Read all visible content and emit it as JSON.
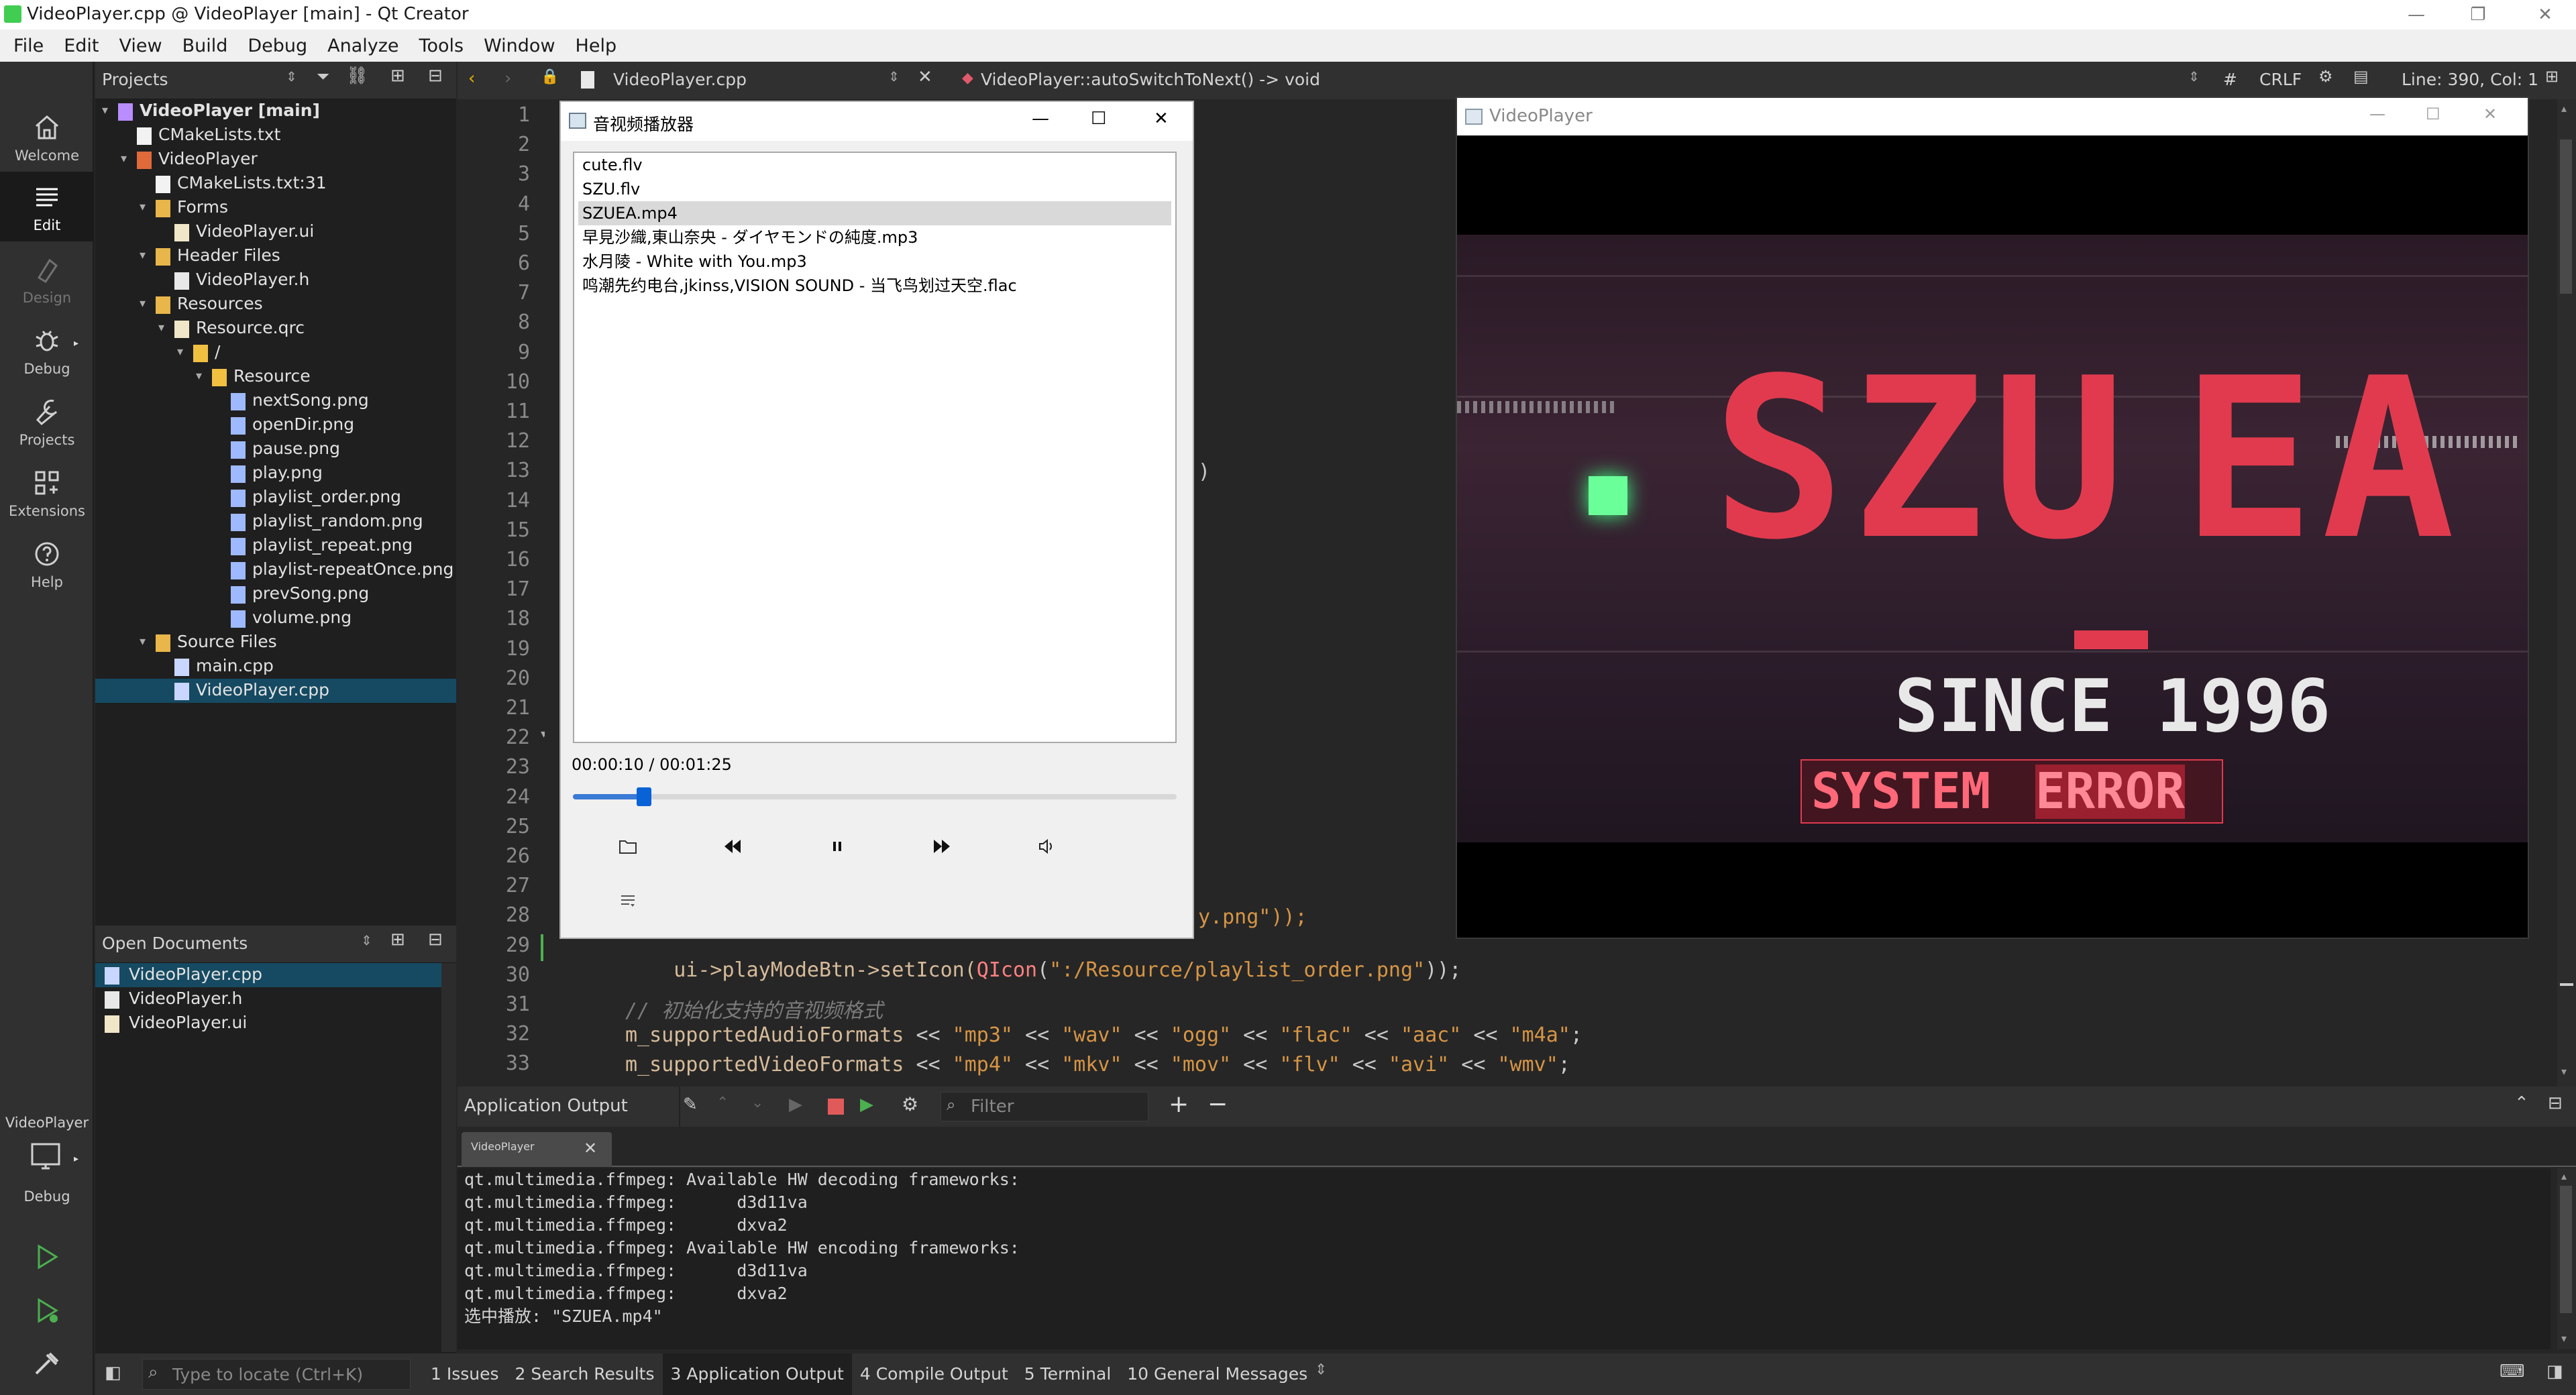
{
  "titlebar": {
    "title": "VideoPlayer.cpp @ VideoPlayer [main] - Qt Creator"
  },
  "menubar": {
    "items": [
      "File",
      "Edit",
      "View",
      "Build",
      "Debug",
      "Analyze",
      "Tools",
      "Window",
      "Help"
    ]
  },
  "modes": [
    {
      "label": "Welcome",
      "icon": "home-icon"
    },
    {
      "label": "Edit",
      "icon": "edit-icon"
    },
    {
      "label": "Design",
      "icon": "design-icon"
    },
    {
      "label": "Debug",
      "icon": "debug-icon"
    },
    {
      "label": "Projects",
      "icon": "wrench-icon"
    },
    {
      "label": "Extensions",
      "icon": "extensions-icon"
    },
    {
      "label": "Help",
      "icon": "help-icon"
    }
  ],
  "kit": {
    "project": "VideoPlayer",
    "mode": "Debug"
  },
  "projects": {
    "header": "Projects",
    "tree": [
      {
        "label": "VideoPlayer [main]",
        "bold": true
      },
      {
        "label": "CMakeLists.txt"
      },
      {
        "label": "VideoPlayer"
      },
      {
        "label": "CMakeLists.txt:31"
      },
      {
        "label": "Forms"
      },
      {
        "label": "VideoPlayer.ui"
      },
      {
        "label": "Header Files"
      },
      {
        "label": "VideoPlayer.h"
      },
      {
        "label": "Resources"
      },
      {
        "label": "Resource.qrc"
      },
      {
        "label": "/"
      },
      {
        "label": "Resource"
      },
      {
        "label": "nextSong.png"
      },
      {
        "label": "openDir.png"
      },
      {
        "label": "pause.png"
      },
      {
        "label": "play.png"
      },
      {
        "label": "playlist_order.png"
      },
      {
        "label": "playlist_random.png"
      },
      {
        "label": "playlist_repeat.png"
      },
      {
        "label": "playlist-repeatOnce.png"
      },
      {
        "label": "prevSong.png"
      },
      {
        "label": "volume.png"
      },
      {
        "label": "Source Files"
      },
      {
        "label": "main.cpp"
      },
      {
        "label": "VideoPlayer.cpp",
        "selected": true
      }
    ]
  },
  "open_documents": {
    "header": "Open Documents",
    "items": [
      {
        "label": "VideoPlayer.cpp",
        "selected": true
      },
      {
        "label": "VideoPlayer.h"
      },
      {
        "label": "VideoPlayer.ui"
      }
    ]
  },
  "editor": {
    "file": "VideoPlayer.cpp",
    "symbol": "VideoPlayer::autoSwitchToNext() -> void",
    "hash": "#",
    "line_ending": "CRLF",
    "position": "Line: 390, Col: 1",
    "line_numbers": [
      "1",
      "2",
      "3",
      "4",
      "5",
      "6",
      "7",
      "8",
      "9",
      "10",
      "11",
      "12",
      "13",
      "14",
      "15",
      "16",
      "17",
      "18",
      "19",
      "20",
      "21",
      "22",
      "23",
      "24",
      "25",
      "26",
      "27",
      "28",
      "29",
      "30",
      "31",
      "32",
      "33"
    ],
    "visible_fragments": {
      "l13": ")",
      "l28": "y.png\"));",
      "l29_a": "ui->playModeBtn->setIcon(",
      "l29_b": "QIcon",
      "l29_c": "(",
      "l29_d": "\":/Resource/playlist_order.png\"",
      "l29_e": "));",
      "l31": "// 初始化支持的音视频格式",
      "l32_var": "m_supportedAudioFormats",
      "l32_items": [
        "\"mp3\"",
        "\"wav\"",
        "\"ogg\"",
        "\"flac\"",
        "\"aac\"",
        "\"m4a\""
      ],
      "l33_var": "m_supportedVideoFormats",
      "l33_items": [
        "\"mp4\"",
        "\"mkv\"",
        "\"mov\"",
        "\"flv\"",
        "\"avi\"",
        "\"wmv\""
      ],
      "op": "<<",
      "end": ";"
    }
  },
  "media_dialog": {
    "title": "音视频播放器",
    "playlist": [
      {
        "name": "cute.flv"
      },
      {
        "name": "SZU.flv"
      },
      {
        "name": "SZUEA.mp4",
        "selected": true
      },
      {
        "name": "早見沙織,東山奈央 - ダイヤモンドの純度.mp3"
      },
      {
        "name": "水月陵 - White with You.mp3"
      },
      {
        "name": "鸣潮先约电台,jkinss,VISION SOUND - 当飞鸟划过天空.flac"
      }
    ],
    "time": "00:00:10 / 00:01:25",
    "progress": 0.118
  },
  "video_window": {
    "title": "VideoPlayer",
    "frame_text": {
      "main_left": "SZU",
      "main_right": "EA",
      "since": "SINCE 1996",
      "error_a": "SYSTEM ",
      "error_b": "ERROR"
    }
  },
  "output": {
    "header": "Application Output",
    "filter_placeholder": "Filter",
    "tab": "VideoPlayer",
    "lines": [
      "qt.multimedia.ffmpeg: Available HW decoding frameworks:",
      "qt.multimedia.ffmpeg:      d3d11va",
      "qt.multimedia.ffmpeg:      dxva2",
      "qt.multimedia.ffmpeg: Available HW encoding frameworks:",
      "qt.multimedia.ffmpeg:      d3d11va",
      "qt.multimedia.ffmpeg:      dxva2",
      "选中播放: \"SZUEA.mp4\""
    ]
  },
  "statusbar": {
    "locator_placeholder": "Type to locate (Ctrl+K)",
    "tabs": [
      {
        "num": "1",
        "label": "Issues"
      },
      {
        "num": "2",
        "label": "Search Results"
      },
      {
        "num": "3",
        "label": "Application Output",
        "active": true
      },
      {
        "num": "4",
        "label": "Compile Output"
      },
      {
        "num": "5",
        "label": "Terminal"
      },
      {
        "num": "10",
        "label": "General Messages"
      }
    ]
  },
  "colors": {
    "selection": "#154a62",
    "string": "#d69545",
    "identifier": "#d6bb9a",
    "accent_red": "#e13a4e",
    "slider": "#0a63d6"
  }
}
